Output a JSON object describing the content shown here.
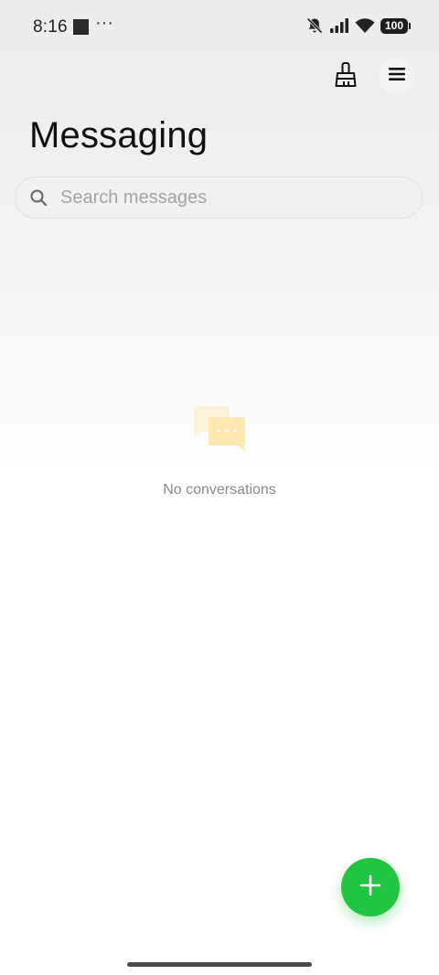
{
  "status_bar": {
    "time": "8:16",
    "overflow": "···",
    "battery": "100",
    "icons": [
      "notifications-muted-icon",
      "signal-icon",
      "wifi-icon",
      "battery-icon"
    ]
  },
  "header": {
    "title": "Messaging",
    "actions": [
      "brush-icon",
      "menu-icon"
    ]
  },
  "search": {
    "placeholder": "Search messages",
    "value": ""
  },
  "empty_state": {
    "message": "No conversations",
    "icon": "chat-bubbles-icon"
  },
  "fab": {
    "icon": "plus-icon",
    "color": "#22c540"
  },
  "colors": {
    "accent": "#22c540",
    "illustration": "#fde9b0"
  }
}
